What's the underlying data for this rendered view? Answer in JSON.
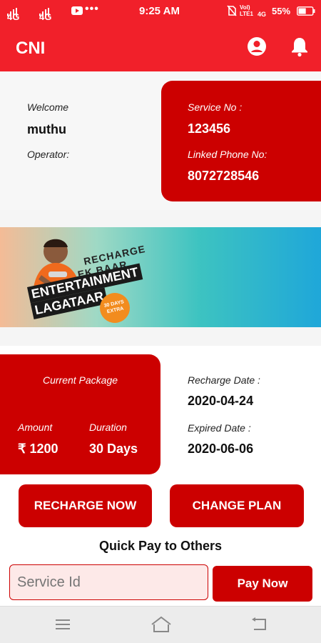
{
  "status_bar": {
    "left_network_1": "4G",
    "left_network_2": "4G",
    "time": "9:25 AM",
    "volte": "Vol) LTE1",
    "right_network": "4G",
    "battery_percent": "55%",
    "battery_level": 0.55
  },
  "app_bar": {
    "title": "CNI",
    "icons": [
      "account-icon",
      "bell-icon"
    ]
  },
  "welcome_card": {
    "welcome_label": "Welcome",
    "user_name": "muthu",
    "operator_label": "Operator:"
  },
  "service_card": {
    "service_no_label": "Service No :",
    "service_no": "123456",
    "linked_phone_label": "Linked Phone No:",
    "linked_phone": "8072728546"
  },
  "banner": {
    "line1": "RECHARGE",
    "line2": "EK BAAR",
    "line3": "ENTERTAINMENT",
    "line4": "LAGATAAR",
    "badge": "30 DAYS EXTRA"
  },
  "package": {
    "title": "Current Package",
    "amount_label": "Amount",
    "amount_value": "₹  1200",
    "duration_label": "Duration",
    "duration_value": "30 Days"
  },
  "dates": {
    "recharge_label": "Recharge Date :",
    "recharge_date": "2020-04-24",
    "expired_label": "Expired Date :",
    "expired_date": "2020-06-06"
  },
  "buttons": {
    "recharge_now": "RECHARGE NOW",
    "change_plan": "CHANGE PLAN"
  },
  "quick_pay": {
    "heading": "Quick Pay to Others",
    "placeholder": "Service Id",
    "pay_button": "Pay Now"
  },
  "colors": {
    "primary_red": "#f1202a",
    "card_red": "#cc0000"
  }
}
